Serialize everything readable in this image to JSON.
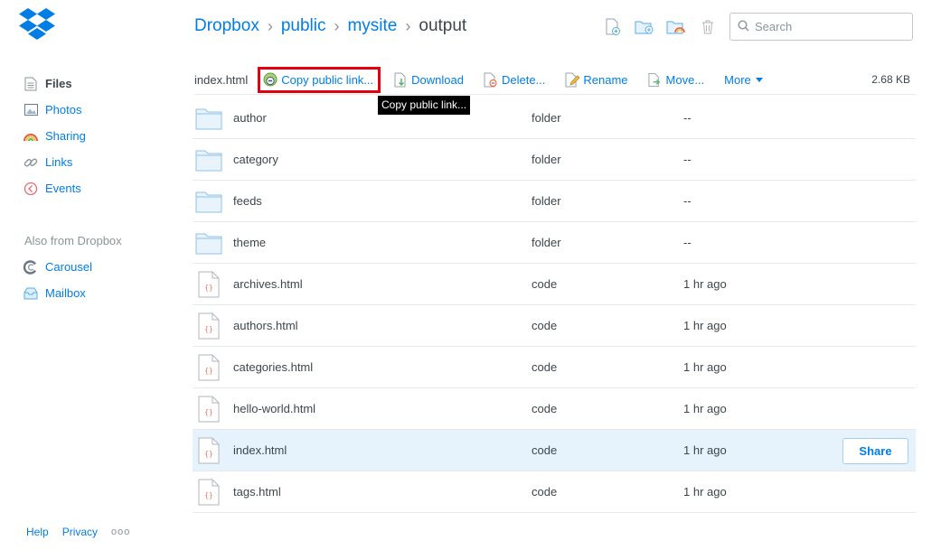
{
  "breadcrumb": [
    {
      "label": "Dropbox"
    },
    {
      "label": "public"
    },
    {
      "label": "mysite"
    },
    {
      "label": "output"
    }
  ],
  "breadcrumb_separator": "›",
  "search": {
    "placeholder": "Search"
  },
  "sidebar": {
    "items": [
      {
        "label": "Files",
        "icon": "files-icon",
        "active": true
      },
      {
        "label": "Photos",
        "icon": "photos-icon"
      },
      {
        "label": "Sharing",
        "icon": "sharing-icon"
      },
      {
        "label": "Links",
        "icon": "links-icon"
      },
      {
        "label": "Events",
        "icon": "events-icon"
      }
    ],
    "also_heading": "Also from Dropbox",
    "also_items": [
      {
        "label": "Carousel",
        "icon": "carousel-icon"
      },
      {
        "label": "Mailbox",
        "icon": "mailbox-icon"
      }
    ]
  },
  "footer": {
    "help": "Help",
    "privacy": "Privacy",
    "more": "ooo"
  },
  "action_bar": {
    "selected_file": "index.html",
    "copy_link": "Copy public link...",
    "download": "Download",
    "delete": "Delete...",
    "rename": "Rename",
    "move": "Move...",
    "more": "More",
    "size": "2.68 KB"
  },
  "tooltip": "Copy public link...",
  "files": [
    {
      "name": "author",
      "kind": "folder",
      "modified": "--",
      "type": "folder"
    },
    {
      "name": "category",
      "kind": "folder",
      "modified": "--",
      "type": "folder"
    },
    {
      "name": "feeds",
      "kind": "folder",
      "modified": "--",
      "type": "folder"
    },
    {
      "name": "theme",
      "kind": "folder",
      "modified": "--",
      "type": "folder"
    },
    {
      "name": "archives.html",
      "kind": "code",
      "modified": "1 hr ago",
      "type": "code"
    },
    {
      "name": "authors.html",
      "kind": "code",
      "modified": "1 hr ago",
      "type": "code"
    },
    {
      "name": "categories.html",
      "kind": "code",
      "modified": "1 hr ago",
      "type": "code"
    },
    {
      "name": "hello-world.html",
      "kind": "code",
      "modified": "1 hr ago",
      "type": "code"
    },
    {
      "name": "index.html",
      "kind": "code",
      "modified": "1 hr ago",
      "type": "code",
      "selected": true
    },
    {
      "name": "tags.html",
      "kind": "code",
      "modified": "1 hr ago",
      "type": "code"
    }
  ],
  "share_label": "Share",
  "colors": {
    "accent": "#007ee5",
    "text": "#3d464d",
    "muted": "#8b949b",
    "selected_row": "#e6f3fc",
    "highlight_border": "#e3000f",
    "folder": "#a3cff3"
  }
}
